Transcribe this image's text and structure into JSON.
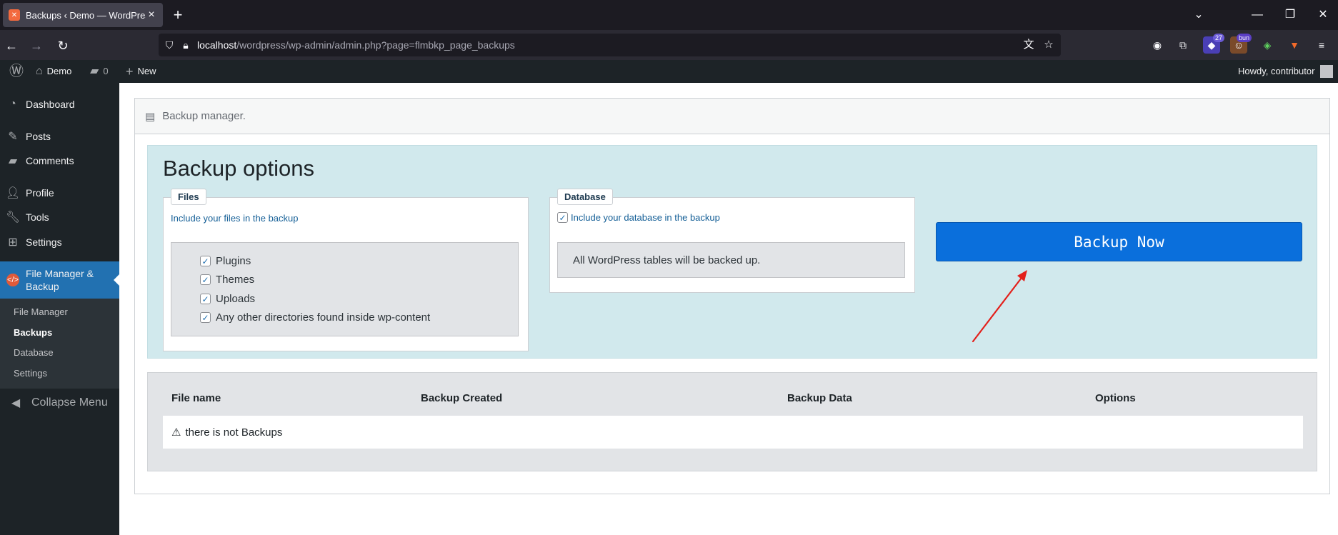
{
  "browser": {
    "tab_title": "Backups ‹ Demo — WordPress",
    "url_host": "localhost",
    "url_path": "/wordpress/wp-admin/admin.php?page=flmbkp_page_backups",
    "ext_badge_count": "27",
    "ext_badge_label": "bun"
  },
  "adminbar": {
    "site_name": "Demo",
    "comments_count": "0",
    "new_label": "New",
    "howdy": "Howdy, contributor"
  },
  "sidebar": {
    "items": [
      {
        "label": "Dashboard"
      },
      {
        "label": "Posts"
      },
      {
        "label": "Comments"
      },
      {
        "label": "Profile"
      },
      {
        "label": "Tools"
      },
      {
        "label": "Settings"
      },
      {
        "label": "File Manager & Backup"
      }
    ],
    "submenu": [
      {
        "label": "File Manager"
      },
      {
        "label": "Backups"
      },
      {
        "label": "Database"
      },
      {
        "label": "Settings"
      }
    ],
    "collapse_label": "Collapse Menu"
  },
  "panel": {
    "header": "Backup manager.",
    "options_title": "Backup options",
    "files": {
      "legend": "Files",
      "description": "Include your files in the backup",
      "options": [
        "Plugins",
        "Themes",
        "Uploads",
        "Any other directories found inside wp-content"
      ]
    },
    "database": {
      "legend": "Database",
      "checkbox_label": "Include your database in the backup",
      "info": "All WordPress tables will be backed up."
    },
    "backup_button": "Backup Now",
    "table": {
      "columns": [
        "File name",
        "Backup Created",
        "Backup Data",
        "Options"
      ],
      "empty_message": "there is not Backups"
    }
  },
  "colors": {
    "wp_dark": "#1d2327",
    "wp_blue": "#2271b1",
    "button_blue": "#0a6fdc",
    "options_bg": "#d1e9ed",
    "annotation_red": "#e3201b"
  }
}
